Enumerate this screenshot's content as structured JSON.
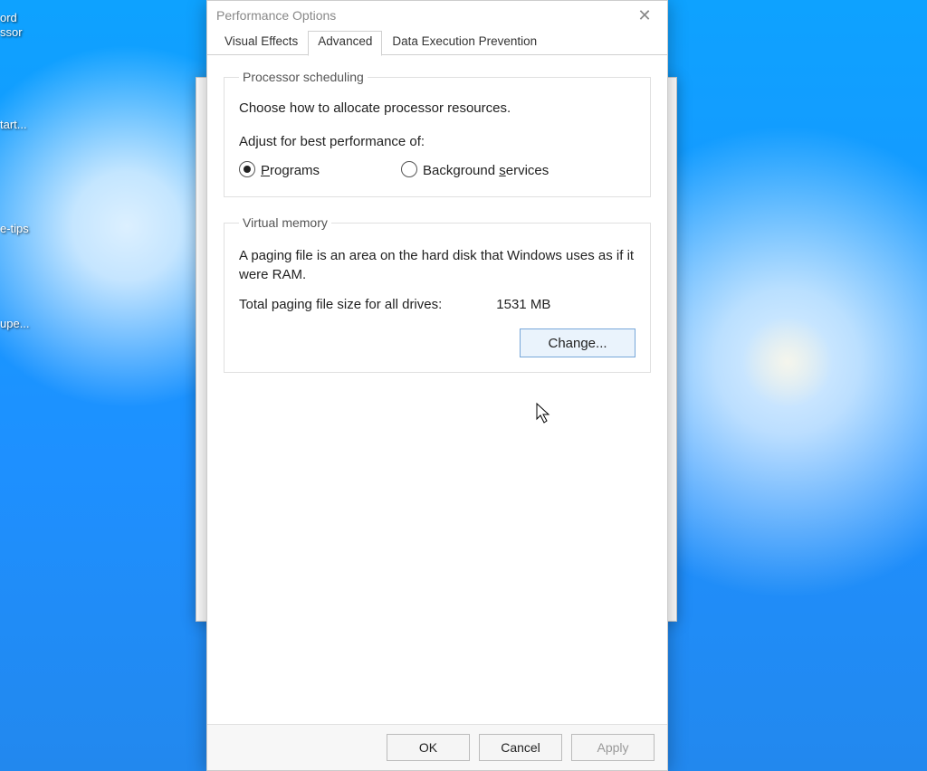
{
  "desktop": {
    "icons": [
      {
        "label": "ord\nssor"
      },
      {
        "label": "tart..."
      },
      {
        "label": "e-tips"
      },
      {
        "label": "upe..."
      }
    ]
  },
  "dialog": {
    "title": "Performance Options",
    "tabs": {
      "visual_effects": "Visual Effects",
      "advanced": "Advanced",
      "dep": "Data Execution Prevention"
    },
    "processor_scheduling": {
      "legend": "Processor scheduling",
      "desc": "Choose how to allocate processor resources.",
      "adjust_label": "Adjust for best performance of:",
      "option_programs": "Programs",
      "option_background": "Background services",
      "selected": "programs"
    },
    "virtual_memory": {
      "legend": "Virtual memory",
      "desc": "A paging file is an area on the hard disk that Windows uses as if it were RAM.",
      "total_label": "Total paging file size for all drives:",
      "total_value": "1531 MB",
      "change_label": "Change..."
    },
    "buttons": {
      "ok": "OK",
      "cancel": "Cancel",
      "apply": "Apply"
    }
  }
}
